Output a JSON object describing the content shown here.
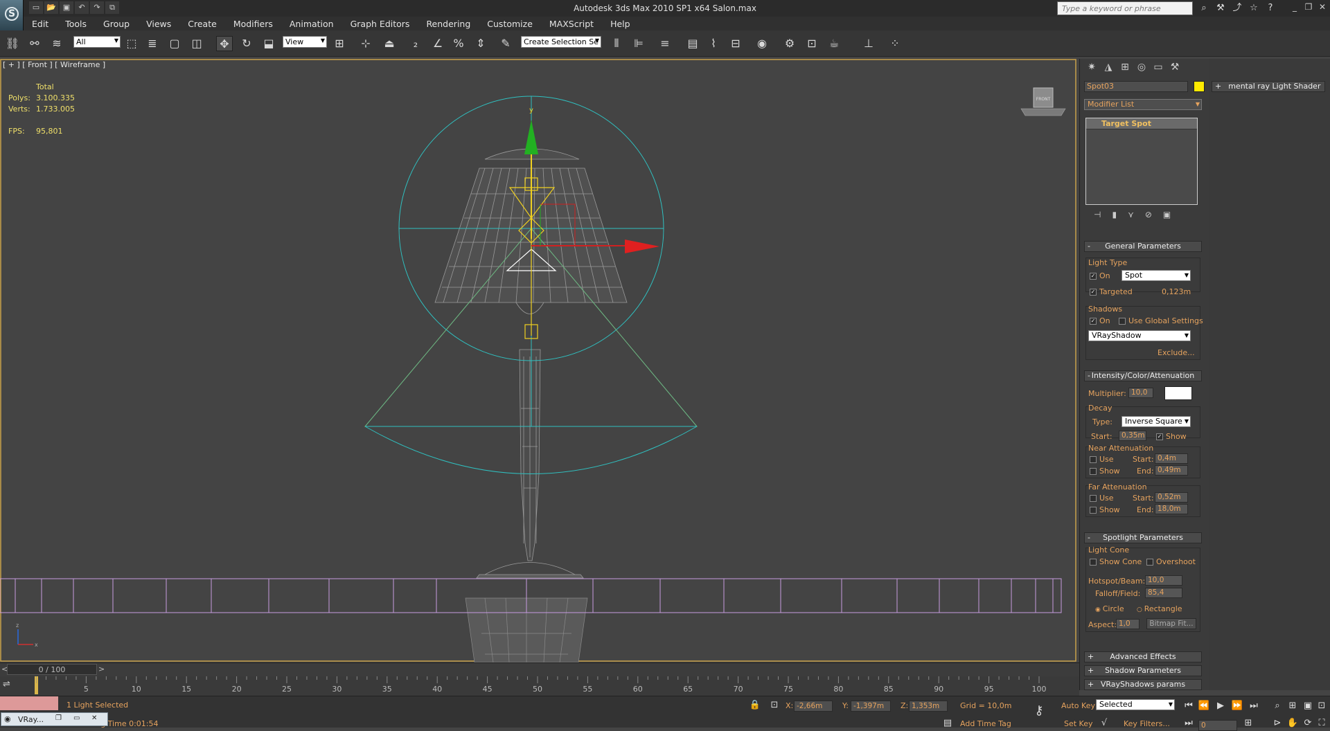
{
  "window": {
    "title": "Autodesk 3ds Max  2010 SP1 x64      Salon.max",
    "search_placeholder": "Type a keyword or phrase",
    "minimize": "_",
    "restore": "❐",
    "close": "✕"
  },
  "menu": [
    "Edit",
    "Tools",
    "Group",
    "Views",
    "Create",
    "Modifiers",
    "Animation",
    "Graph Editors",
    "Rendering",
    "Customize",
    "MAXScript",
    "Help"
  ],
  "toolbar": {
    "filter_value": "All",
    "coord_system": "View",
    "selection_set": "Create Selection Se"
  },
  "viewport": {
    "label": "[ + ] [ Front ] [ Wireframe ]",
    "stats": {
      "header": "Total",
      "polys_label": "Polys:",
      "polys_value": "3.100.335",
      "verts_label": "Verts:",
      "verts_value": "1.733.005",
      "fps_label": "FPS:",
      "fps_value": "95,801"
    },
    "viewcube_label": "FRONT",
    "gizmo_label": "y",
    "axis_labels": {
      "z": "z",
      "x": "x"
    }
  },
  "command_panel": {
    "object_name": "Spot03",
    "object_color": "#ffea00",
    "modifier_list": "Modifier List",
    "stack_item": "Target Spot",
    "general_parameters": {
      "header": "General Parameters",
      "light_type_label": "Light Type",
      "on_label": "On",
      "light_type_value": "Spot",
      "targeted_label": "Targeted",
      "targeted_distance": "0,123m",
      "shadows_label": "Shadows",
      "shadows_on_label": "On",
      "use_global_label": "Use Global Settings",
      "shadow_type": "VRayShadow",
      "exclude_label": "Exclude..."
    },
    "intensity": {
      "header": "Intensity/Color/Attenuation",
      "multiplier_label": "Multiplier:",
      "multiplier_value": "10,0",
      "decay_label": "Decay",
      "type_label": "Type:",
      "decay_type": "Inverse Square",
      "start_label": "Start:",
      "start_value": "0,35m",
      "show_label": "Show",
      "near_label": "Near Attenuation",
      "near_use": "Use",
      "near_show": "Show",
      "near_start_label": "Start:",
      "near_start_value": "0,4m",
      "near_end_label": "End:",
      "near_end_value": "0,49m",
      "far_label": "Far Attenuation",
      "far_use": "Use",
      "far_show": "Show",
      "far_start_label": "Start:",
      "far_start_value": "0,52m",
      "far_end_label": "End:",
      "far_end_value": "18,0m"
    },
    "spotlight": {
      "header": "Spotlight Parameters",
      "light_cone_label": "Light Cone",
      "show_cone_label": "Show Cone",
      "overshoot_label": "Overshoot",
      "hotspot_label": "Hotspot/Beam:",
      "hotspot_value": "10,0",
      "falloff_label": "Falloff/Field:",
      "falloff_value": "85,4",
      "circle_label": "Circle",
      "rectangle_label": "Rectangle",
      "aspect_label": "Aspect:",
      "aspect_value": "1,0",
      "bitmap_fit_label": "Bitmap Fit..."
    },
    "collapsed_rollouts": [
      "Advanced Effects",
      "Shadow Parameters",
      "VRayShadows params"
    ]
  },
  "shader_panel": {
    "label": "mental ray Light Shader"
  },
  "timeline": {
    "slider_label": "0 / 100",
    "prev": "<",
    "next": ">",
    "ticks": [
      "5",
      "10",
      "15",
      "20",
      "25",
      "30",
      "35",
      "40",
      "45",
      "50",
      "55",
      "60",
      "65",
      "70",
      "75",
      "80",
      "85",
      "90",
      "95",
      "100"
    ]
  },
  "status": {
    "selection": "1 Light Selected",
    "render_time": "Rendering Time  0:01:54",
    "x_label": "X:",
    "x_value": "-2,66m",
    "y_label": "Y:",
    "y_value": "-1,397m",
    "z_label": "Z:",
    "z_value": "1,353m",
    "grid": "Grid = 10,0m",
    "add_time_tag": "Add Time Tag",
    "auto_key": "Auto Key",
    "set_key": "Set Key",
    "key_mode": "Selected",
    "key_filters": "Key Filters...",
    "frame_value": "0",
    "taskbar_app": "VRay..."
  }
}
